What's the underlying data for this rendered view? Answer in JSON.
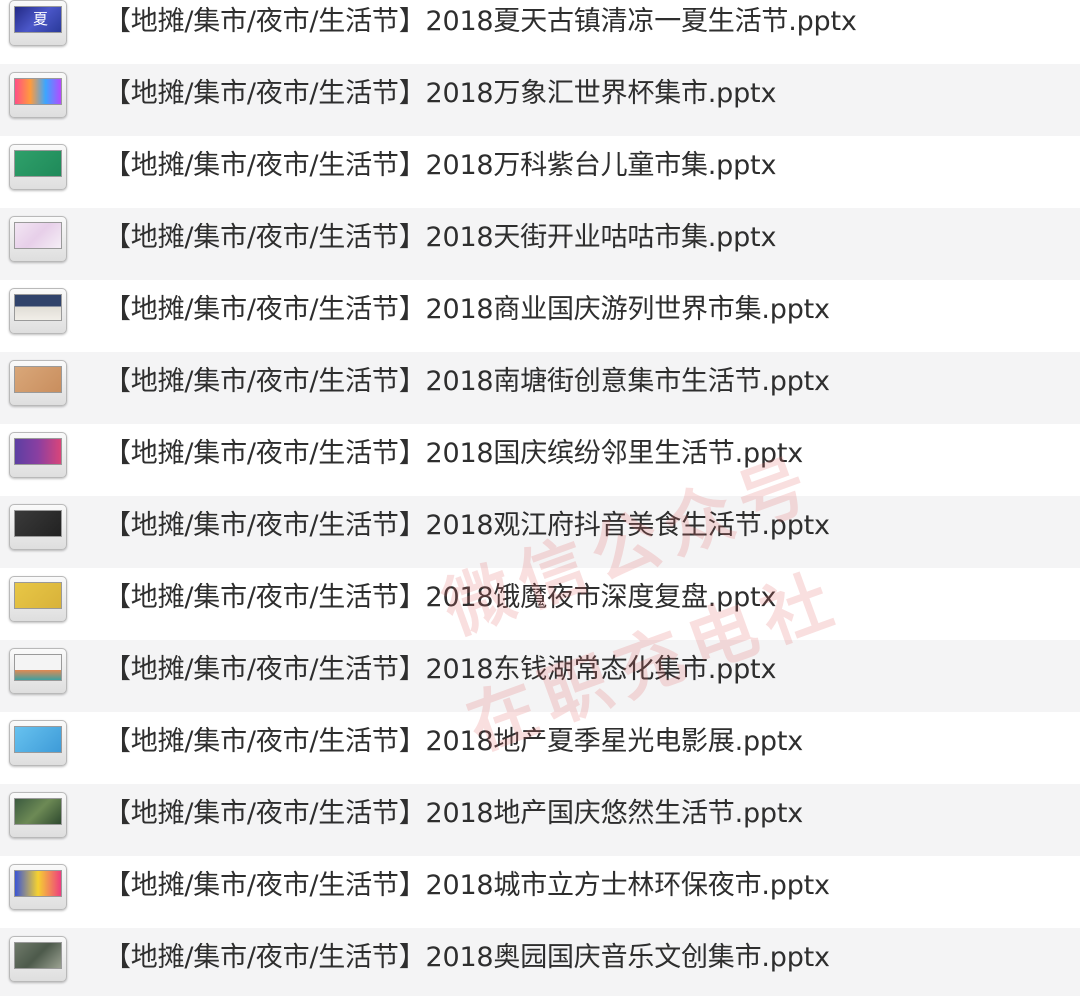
{
  "files": [
    {
      "name": "【地摊/集市/夜市/生活节】2018夏天古镇清凉一夏生活节.pptx",
      "thumb": {
        "bg": "linear-gradient(135deg,#232a86,#4b57c9,#2a3a9a)",
        "text": "夏"
      }
    },
    {
      "name": "【地摊/集市/夜市/生活节】2018万象汇世界杯集市.pptx",
      "thumb": {
        "bg": "linear-gradient(90deg,#ff4f86,#ff9b3d,#3ba6ff,#b44bff)"
      }
    },
    {
      "name": "【地摊/集市/夜市/生活节】2018万科紫台儿童市集.pptx",
      "thumb": {
        "bg": "linear-gradient(135deg,#2fa06a,#1f8a5a)"
      }
    },
    {
      "name": "【地摊/集市/夜市/生活节】2018天街开业咕咕市集.pptx",
      "thumb": {
        "bg": "linear-gradient(135deg,#f2e6f3,#e7cfe9,#f5eef6)"
      }
    },
    {
      "name": "【地摊/集市/夜市/生活节】2018商业国庆游列世界市集.pptx",
      "thumb": {
        "bg": "linear-gradient(180deg,#30436b 0%,#30436b 45%,#e0ddd6 46%,#f1eee8 100%)"
      }
    },
    {
      "name": "【地摊/集市/夜市/生活节】2018南塘街创意集市生活节.pptx",
      "thumb": {
        "bg": "linear-gradient(135deg,#d9a779,#c98e5e)"
      }
    },
    {
      "name": "【地摊/集市/夜市/生活节】2018国庆缤纷邻里生活节.pptx",
      "thumb": {
        "bg": "linear-gradient(90deg,#5c3fa3,#8a3fa1,#d9457a)"
      }
    },
    {
      "name": "【地摊/集市/夜市/生活节】2018观江府抖音美食生活节.pptx",
      "thumb": {
        "bg": "linear-gradient(135deg,#3a3a3a,#222222)"
      }
    },
    {
      "name": "【地摊/集市/夜市/生活节】2018饿魔夜市深度复盘.pptx",
      "thumb": {
        "bg": "linear-gradient(135deg,#e8c746,#d8b23a)"
      }
    },
    {
      "name": "【地摊/集市/夜市/生活节】2018东钱湖常态化集市.pptx",
      "thumb": {
        "bg": "linear-gradient(180deg,#f4f4f4 0%,#f4f4f4 60%,#dd8a55 61%,#3fa0a0 100%)"
      }
    },
    {
      "name": "【地摊/集市/夜市/生活节】2018地产夏季星光电影展.pptx",
      "thumb": {
        "bg": "linear-gradient(135deg,#67c2ef,#3e9bd8)"
      }
    },
    {
      "name": "【地摊/集市/夜市/生活节】2018地产国庆悠然生活节.pptx",
      "thumb": {
        "bg": "linear-gradient(135deg,#3b5a3f,#6d8a55,#2f4a2f)"
      }
    },
    {
      "name": "【地摊/集市/夜市/生活节】2018城市立方士林环保夜市.pptx",
      "thumb": {
        "bg": "linear-gradient(90deg,#3a55d6,#f5d131,#ee3e7f)"
      }
    },
    {
      "name": "【地摊/集市/夜市/生活节】2018奥园国庆音乐文创集市.pptx",
      "thumb": {
        "bg": "linear-gradient(135deg,#6f7a6a,#4d5a4b,#9aa191)"
      }
    }
  ],
  "watermark": {
    "line1": "微信公众号",
    "line2": "在职充电社"
  }
}
